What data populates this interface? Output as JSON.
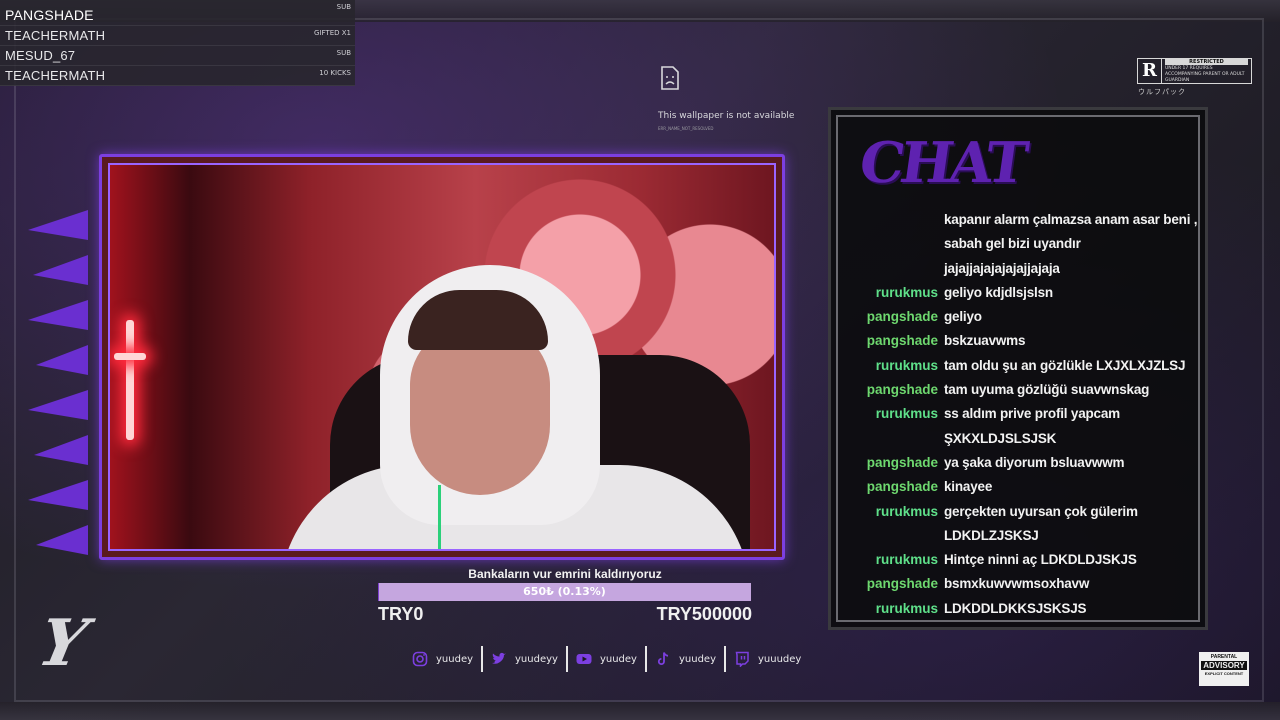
{
  "events": [
    {
      "name": "PANGSHADE",
      "type": "SUB"
    },
    {
      "name": "TEACHERMATH",
      "type": "GIFTED X1"
    },
    {
      "name": "MESUD_67",
      "type": "SUB"
    },
    {
      "name": "TEACHERMATH",
      "type": "10 KICKS"
    }
  ],
  "wallpaper": {
    "message": "This wallpaper is not available",
    "code": "ERR_NAME_NOT_RESOLVED"
  },
  "rating": {
    "letter": "R",
    "label": "RESTRICTED",
    "text": "UNDER 17 REQUIRES ACCOMPANYING PARENT OR ADULT GUARDIAN",
    "kana": "ウルフパック"
  },
  "goal": {
    "title": "Bankaların vur emrini kaldırıyoruz",
    "progress": "650₺ (0.13%)",
    "fraction": 0.0013,
    "min": "TRY0",
    "max": "TRY500000"
  },
  "chat": {
    "logo": "CHAT",
    "messages": [
      {
        "user": "",
        "text": "kapanır alarm çalmazsa anam asar beni ,"
      },
      {
        "user": "",
        "text": "sabah gel bizi uyandır"
      },
      {
        "user": "",
        "text": "jajajjajajajajajjajaja"
      },
      {
        "user": "rurukmus",
        "text": "geliyo kdjdlsjslsn"
      },
      {
        "user": "pangshade",
        "text": "geliyo"
      },
      {
        "user": "pangshade",
        "text": "bskzuavwms"
      },
      {
        "user": "rurukmus",
        "text": "tam oldu şu an gözlükle LXJXLXJZLSJ"
      },
      {
        "user": "pangshade",
        "text": "tam uyuma gözlüğü suavwnskag"
      },
      {
        "user": "rurukmus",
        "text": "ss aldım prive profil yapcam"
      },
      {
        "user": "",
        "text": "ŞXKXLDJSLSJSK"
      },
      {
        "user": "pangshade",
        "text": "ya şaka diyorum bsluavwwm"
      },
      {
        "user": "pangshade",
        "text": "kinayee"
      },
      {
        "user": "rurukmus",
        "text": "gerçekten uyursan çok gülerim"
      },
      {
        "user": "",
        "text": "LDKDLZJSKSJ"
      },
      {
        "user": "rurukmus",
        "text": "Hintçe ninni aç LDKDLDJSKJS"
      },
      {
        "user": "pangshade",
        "text": "bsmxkuwvwmsoxhavw"
      },
      {
        "user": "rurukmus",
        "text": "LDKDDLDKKSJSKSJS"
      }
    ]
  },
  "socials": [
    {
      "icon": "instagram-icon",
      "name": "yuudey"
    },
    {
      "icon": "twitter-icon",
      "name": "yuudeyy"
    },
    {
      "icon": "youtube-icon",
      "name": "yuudey"
    },
    {
      "icon": "tiktok-icon",
      "name": "yuudey"
    },
    {
      "icon": "twitch-icon",
      "name": "yuuudey"
    }
  ],
  "advisory": {
    "top": "PARENTAL",
    "middle": "ADVISORY",
    "bottom": "EXPLICIT CONTENT"
  },
  "colors": {
    "accent": "#7c3fe0",
    "chat_user_rurukmus": "#5fe08a",
    "chat_user_pangshade": "#6ed86f"
  }
}
